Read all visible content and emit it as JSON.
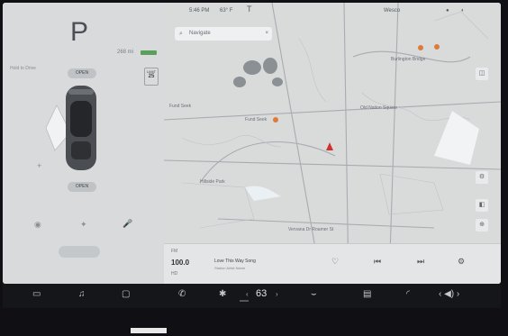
{
  "car": {
    "gear": "P",
    "battery_text": "268 mi",
    "side_info": "Hold to Drive",
    "open_frunk": "OPEN",
    "open_trunk": "OPEN",
    "speed_limit_label": "LIMIT",
    "speed_limit_value": "25"
  },
  "status": {
    "time": "5:46 PM",
    "temp": "63° F",
    "top_right": "Wesco"
  },
  "map": {
    "search_placeholder": "Navigate",
    "labels": [
      "Fund Seek",
      "Fund Seek",
      "Burlington Bridge",
      "Old Nation Square",
      "Hillside Park"
    ],
    "bottom_label": "Vervana Dr  Roamer St"
  },
  "media": {
    "source": "FM",
    "frequency": "100.0",
    "band": "HD",
    "title": "Love This Way Song",
    "artist": "Station Artist Name"
  },
  "climate": {
    "temperature": "63"
  },
  "icons": [
    "car-icon",
    "music-icon",
    "phone-icon",
    "fan-icon",
    "heat-icon",
    "volume-icon"
  ]
}
